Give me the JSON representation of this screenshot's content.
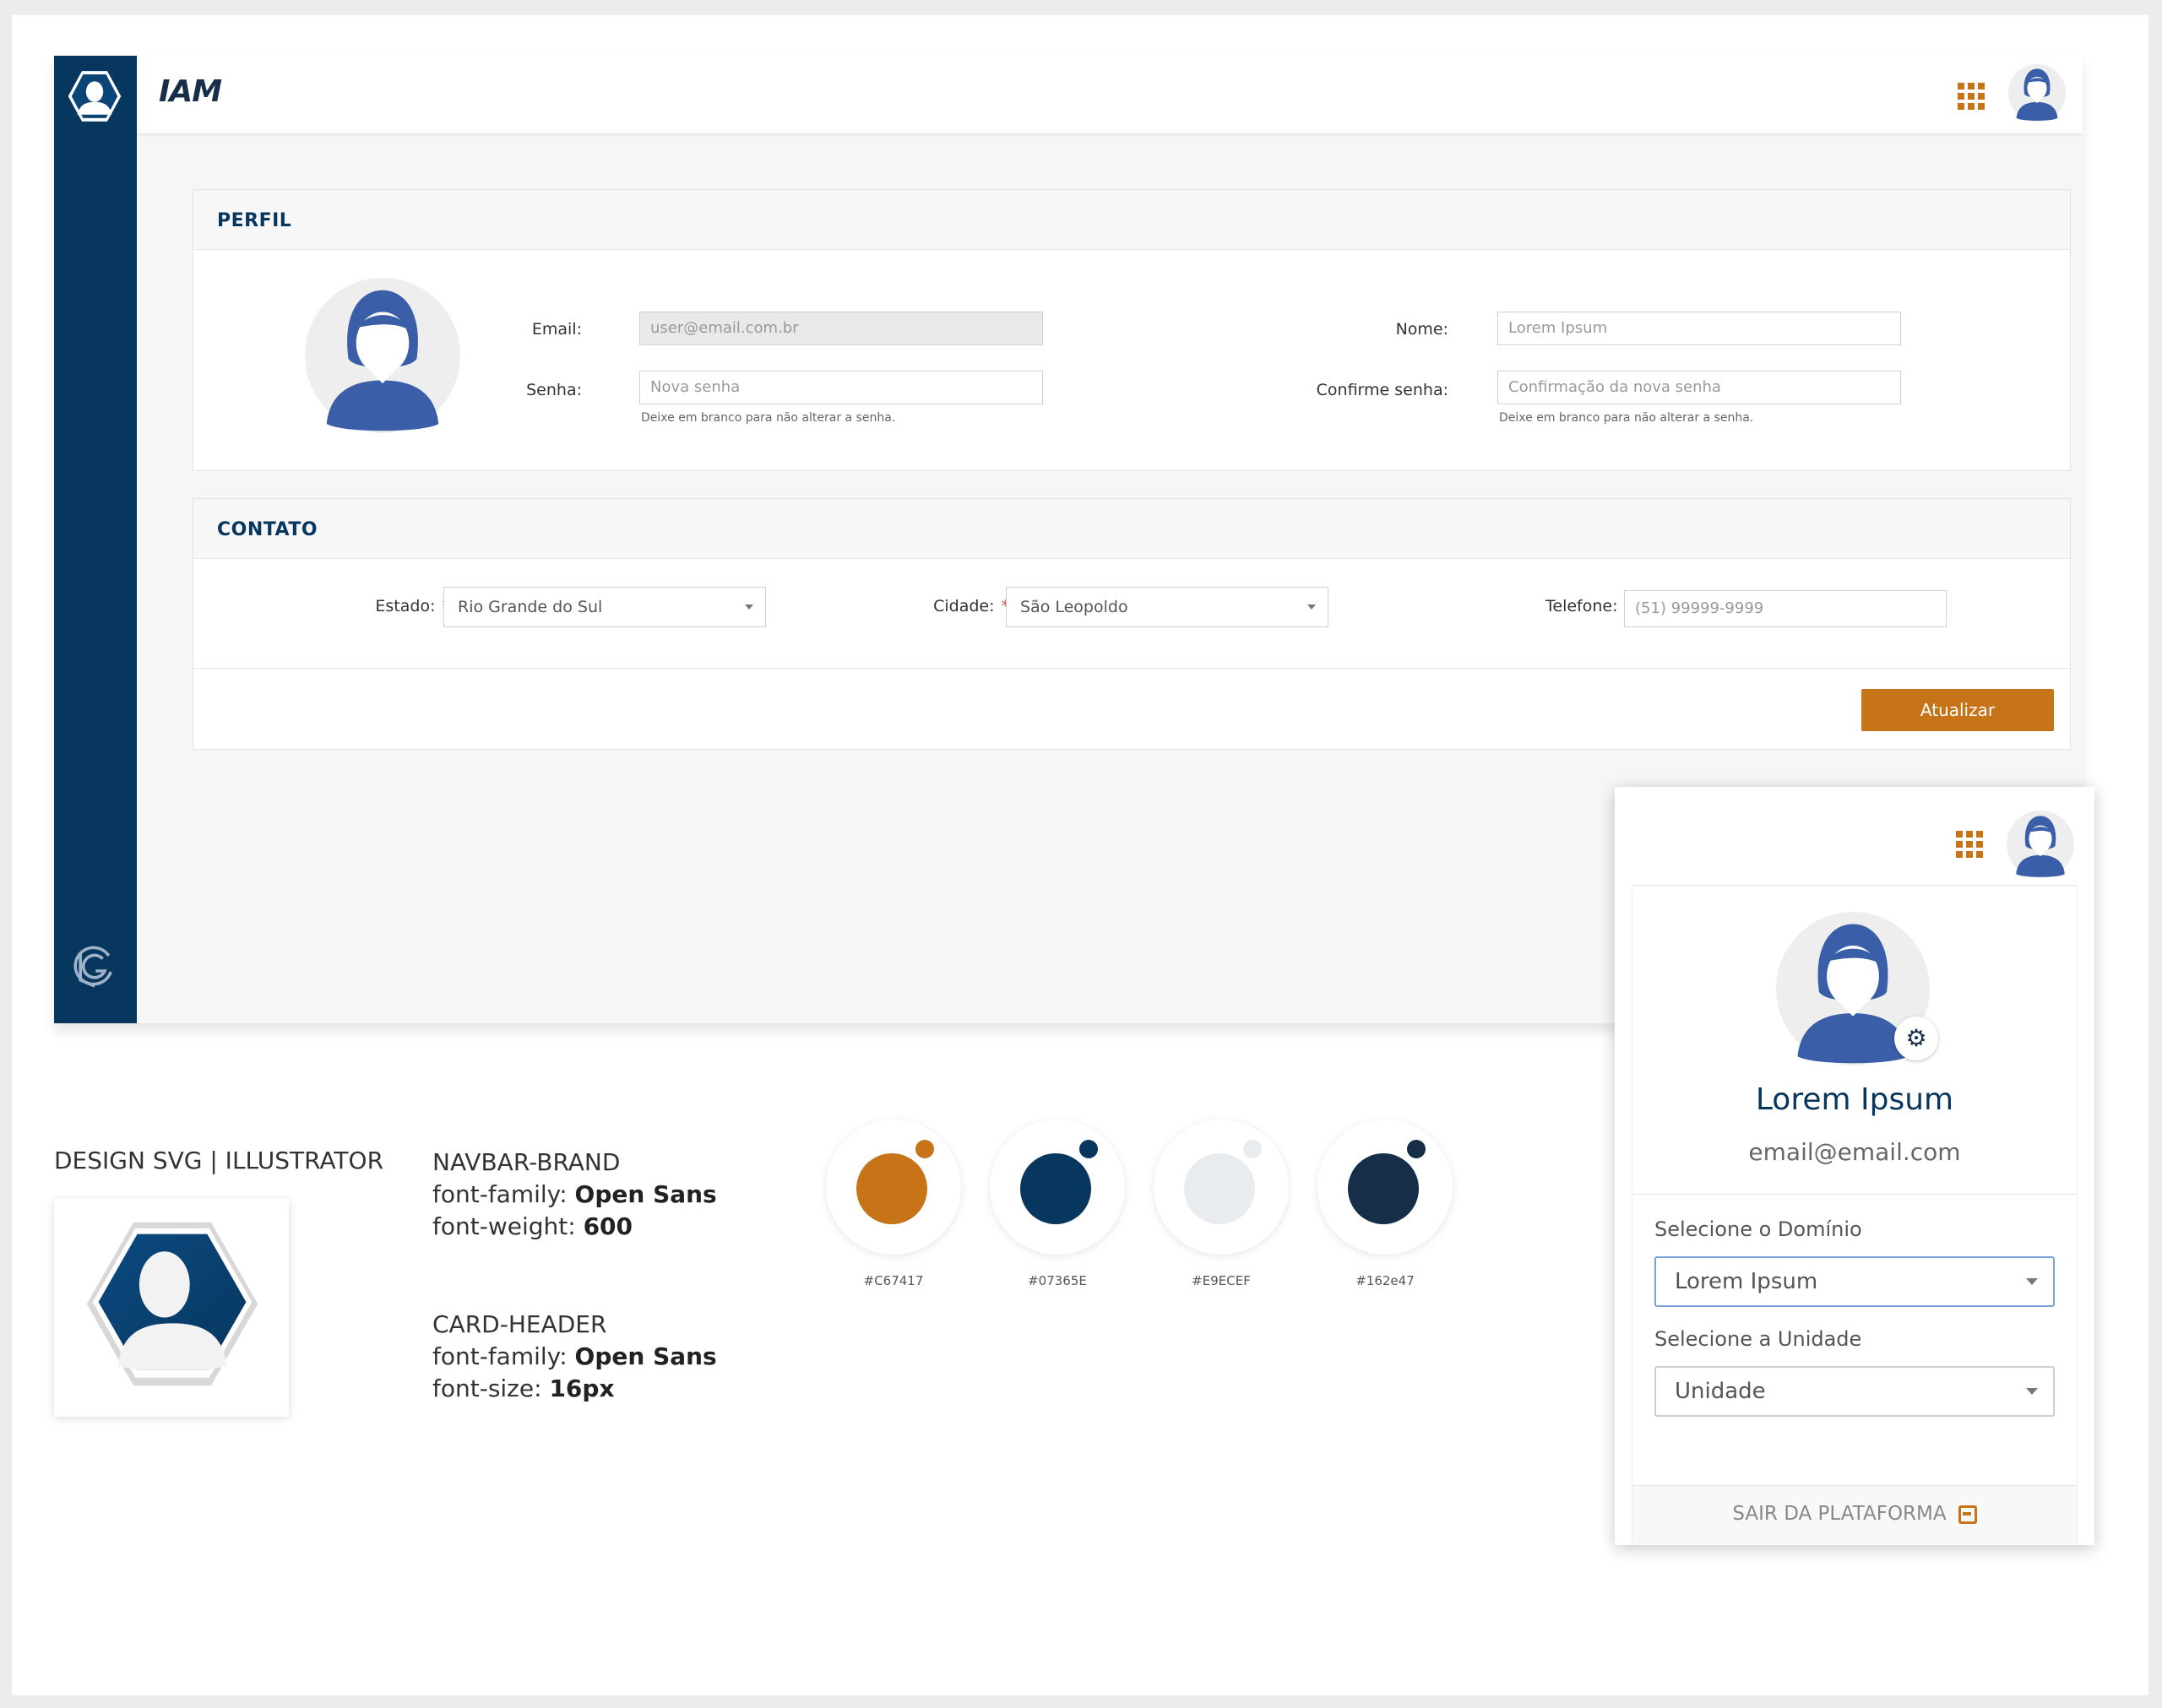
{
  "navbar": {
    "brand": "IAM"
  },
  "profile": {
    "title": "PERFIL",
    "email_label": "Email:",
    "email_value": "user@email.com.br",
    "senha_label": "Senha:",
    "senha_placeholder": "Nova senha",
    "senha_hint": "Deixe em branco para não alterar a senha.",
    "nome_label": "Nome:",
    "nome_placeholder": "Lorem Ipsum",
    "confirme_label": "Confirme senha:",
    "confirme_placeholder": "Confirmação da nova senha",
    "confirme_hint": "Deixe em branco para não alterar a senha."
  },
  "contact": {
    "title": "CONTATO",
    "estado_label": "Estado:",
    "estado_value": "Rio Grande do Sul",
    "cidade_label": "Cidade:",
    "cidade_value": "São Leopoldo",
    "telefone_label": "Telefone:",
    "telefone_placeholder": "(51) 99999-9999",
    "required_mark": "*",
    "submit_label": "Atualizar"
  },
  "user_panel": {
    "name": "Lorem Ipsum",
    "email": "email@email.com",
    "domain_label": "Selecione o Domínio",
    "domain_value": "Lorem Ipsum",
    "unit_label": "Selecione a Unidade",
    "unit_value": "Unidade",
    "logout_label": "SAIR DA PLATAFORMA"
  },
  "design": {
    "title": "DESIGN SVG | ILLUSTRATOR",
    "navbar_brand": {
      "heading": "NAVBAR-BRAND",
      "line1_key": "font-family: ",
      "line1_value": "Open Sans",
      "line2_key": "font-weight: ",
      "line2_value": "600"
    },
    "card_header": {
      "heading": "CARD-HEADER",
      "line1_key": "font-family: ",
      "line1_value": "Open Sans",
      "line2_key": "font-size: ",
      "line2_value": "16px"
    },
    "swatches": [
      {
        "code": "#C67417",
        "color": "#C67417"
      },
      {
        "code": "#07365E",
        "color": "#07365E"
      },
      {
        "code": "#E9ECEF",
        "color": "#E9ECEF"
      },
      {
        "code": "#162e47",
        "color": "#162e47"
      }
    ]
  },
  "icons": {
    "brand_logo": "user-hexagon-icon",
    "apps": "apps-grid-icon",
    "avatar": "user-avatar-icon",
    "footer_logo": "company-logo-icon",
    "gear": "gear-icon",
    "logout": "logout-icon",
    "dropdown": "chevron-down-icon"
  },
  "colors": {
    "primary": "#07365E",
    "accent": "#C67417",
    "light": "#E9ECEF",
    "dark": "#162e47"
  }
}
